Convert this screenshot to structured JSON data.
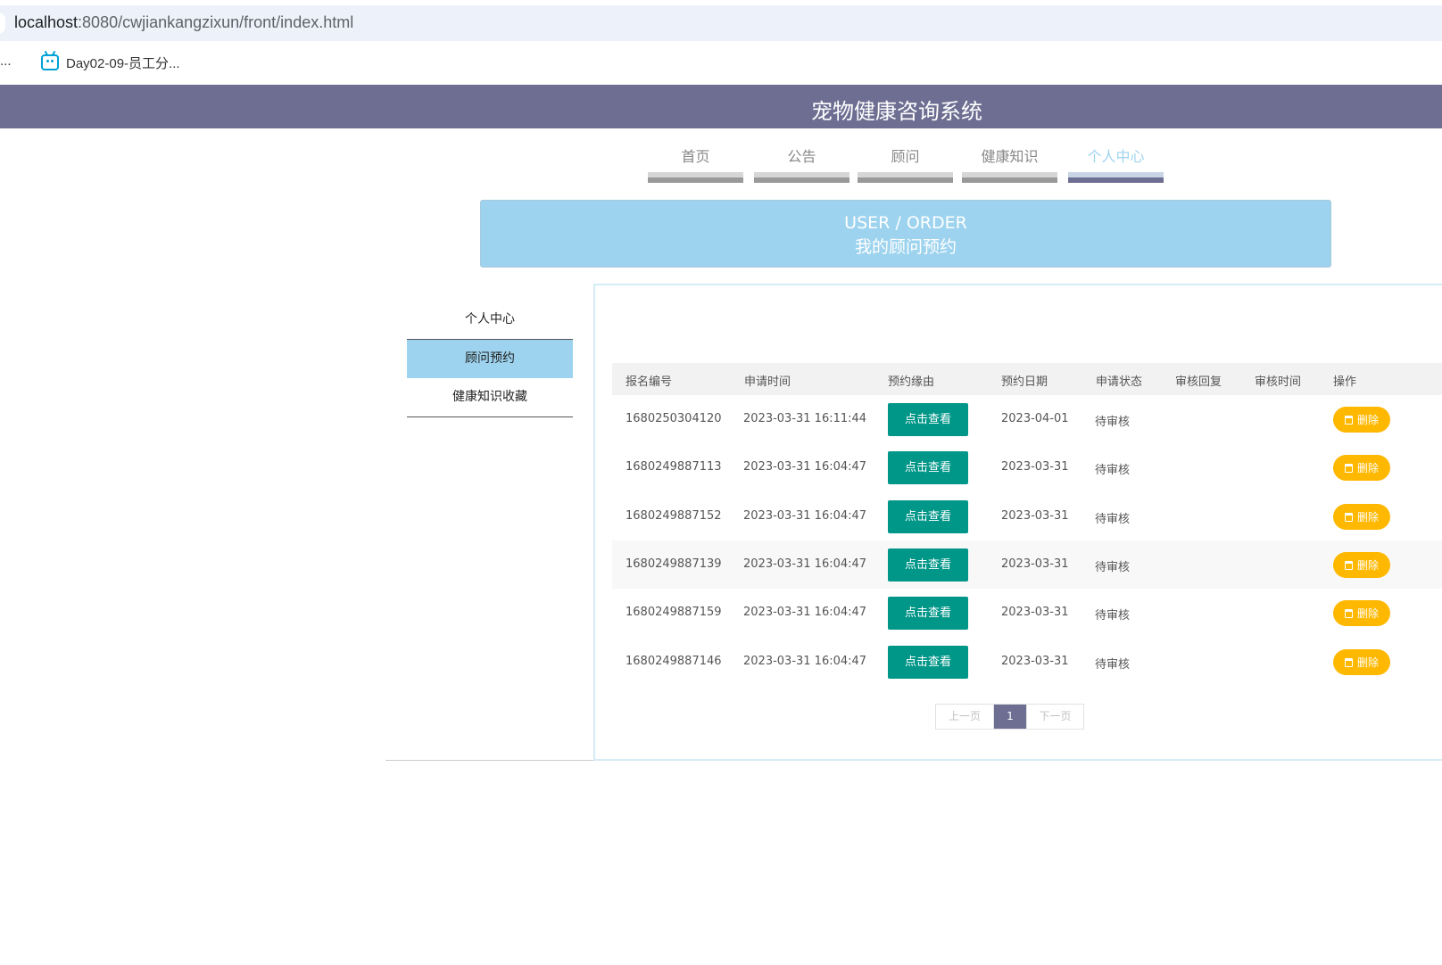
{
  "browser": {
    "url_host": "localhost",
    "url_rest": ":8080/cwjiankangzixun/front/index.html",
    "bookmark_prev": "...",
    "bookmark_label": "Day02-09-员工分..."
  },
  "site": {
    "title": "宠物健康咨询系统"
  },
  "nav": {
    "items": [
      {
        "label": "首页"
      },
      {
        "label": "公告"
      },
      {
        "label": "顾问"
      },
      {
        "label": "健康知识"
      },
      {
        "label": "个人中心"
      }
    ],
    "active": "个人中心"
  },
  "banner": {
    "en": "USER / ORDER",
    "zh": "我的顾问预约"
  },
  "side_menu": {
    "items": [
      {
        "label": "个人中心"
      },
      {
        "label": "顾问预约"
      },
      {
        "label": "健康知识收藏"
      }
    ],
    "active": "顾问预约"
  },
  "table": {
    "headers": [
      "报名编号",
      "申请时间",
      "预约缘由",
      "预约日期",
      "申请状态",
      "审核回复",
      "审核时间",
      "操作"
    ],
    "view_label": "点击查看",
    "delete_label": "删除",
    "rows": [
      {
        "id": "1680250304120",
        "apply_time": "2023-03-31 16:11:44",
        "date": "2023-04-01",
        "status": "待审核"
      },
      {
        "id": "1680249887113",
        "apply_time": "2023-03-31 16:04:47",
        "date": "2023-03-31",
        "status": "待审核"
      },
      {
        "id": "1680249887152",
        "apply_time": "2023-03-31 16:04:47",
        "date": "2023-03-31",
        "status": "待审核"
      },
      {
        "id": "1680249887139",
        "apply_time": "2023-03-31 16:04:47",
        "date": "2023-03-31",
        "status": "待审核"
      },
      {
        "id": "1680249887159",
        "apply_time": "2023-03-31 16:04:47",
        "date": "2023-03-31",
        "status": "待审核"
      },
      {
        "id": "1680249887146",
        "apply_time": "2023-03-31 16:04:47",
        "date": "2023-03-31",
        "status": "待审核"
      }
    ]
  },
  "pagination": {
    "prev": "上一页",
    "current": "1",
    "next": "下一页"
  },
  "colors": {
    "header": "#6e6e93",
    "accent": "#9dd3ee",
    "view_button": "#009688",
    "delete_button": "#ffb800"
  }
}
